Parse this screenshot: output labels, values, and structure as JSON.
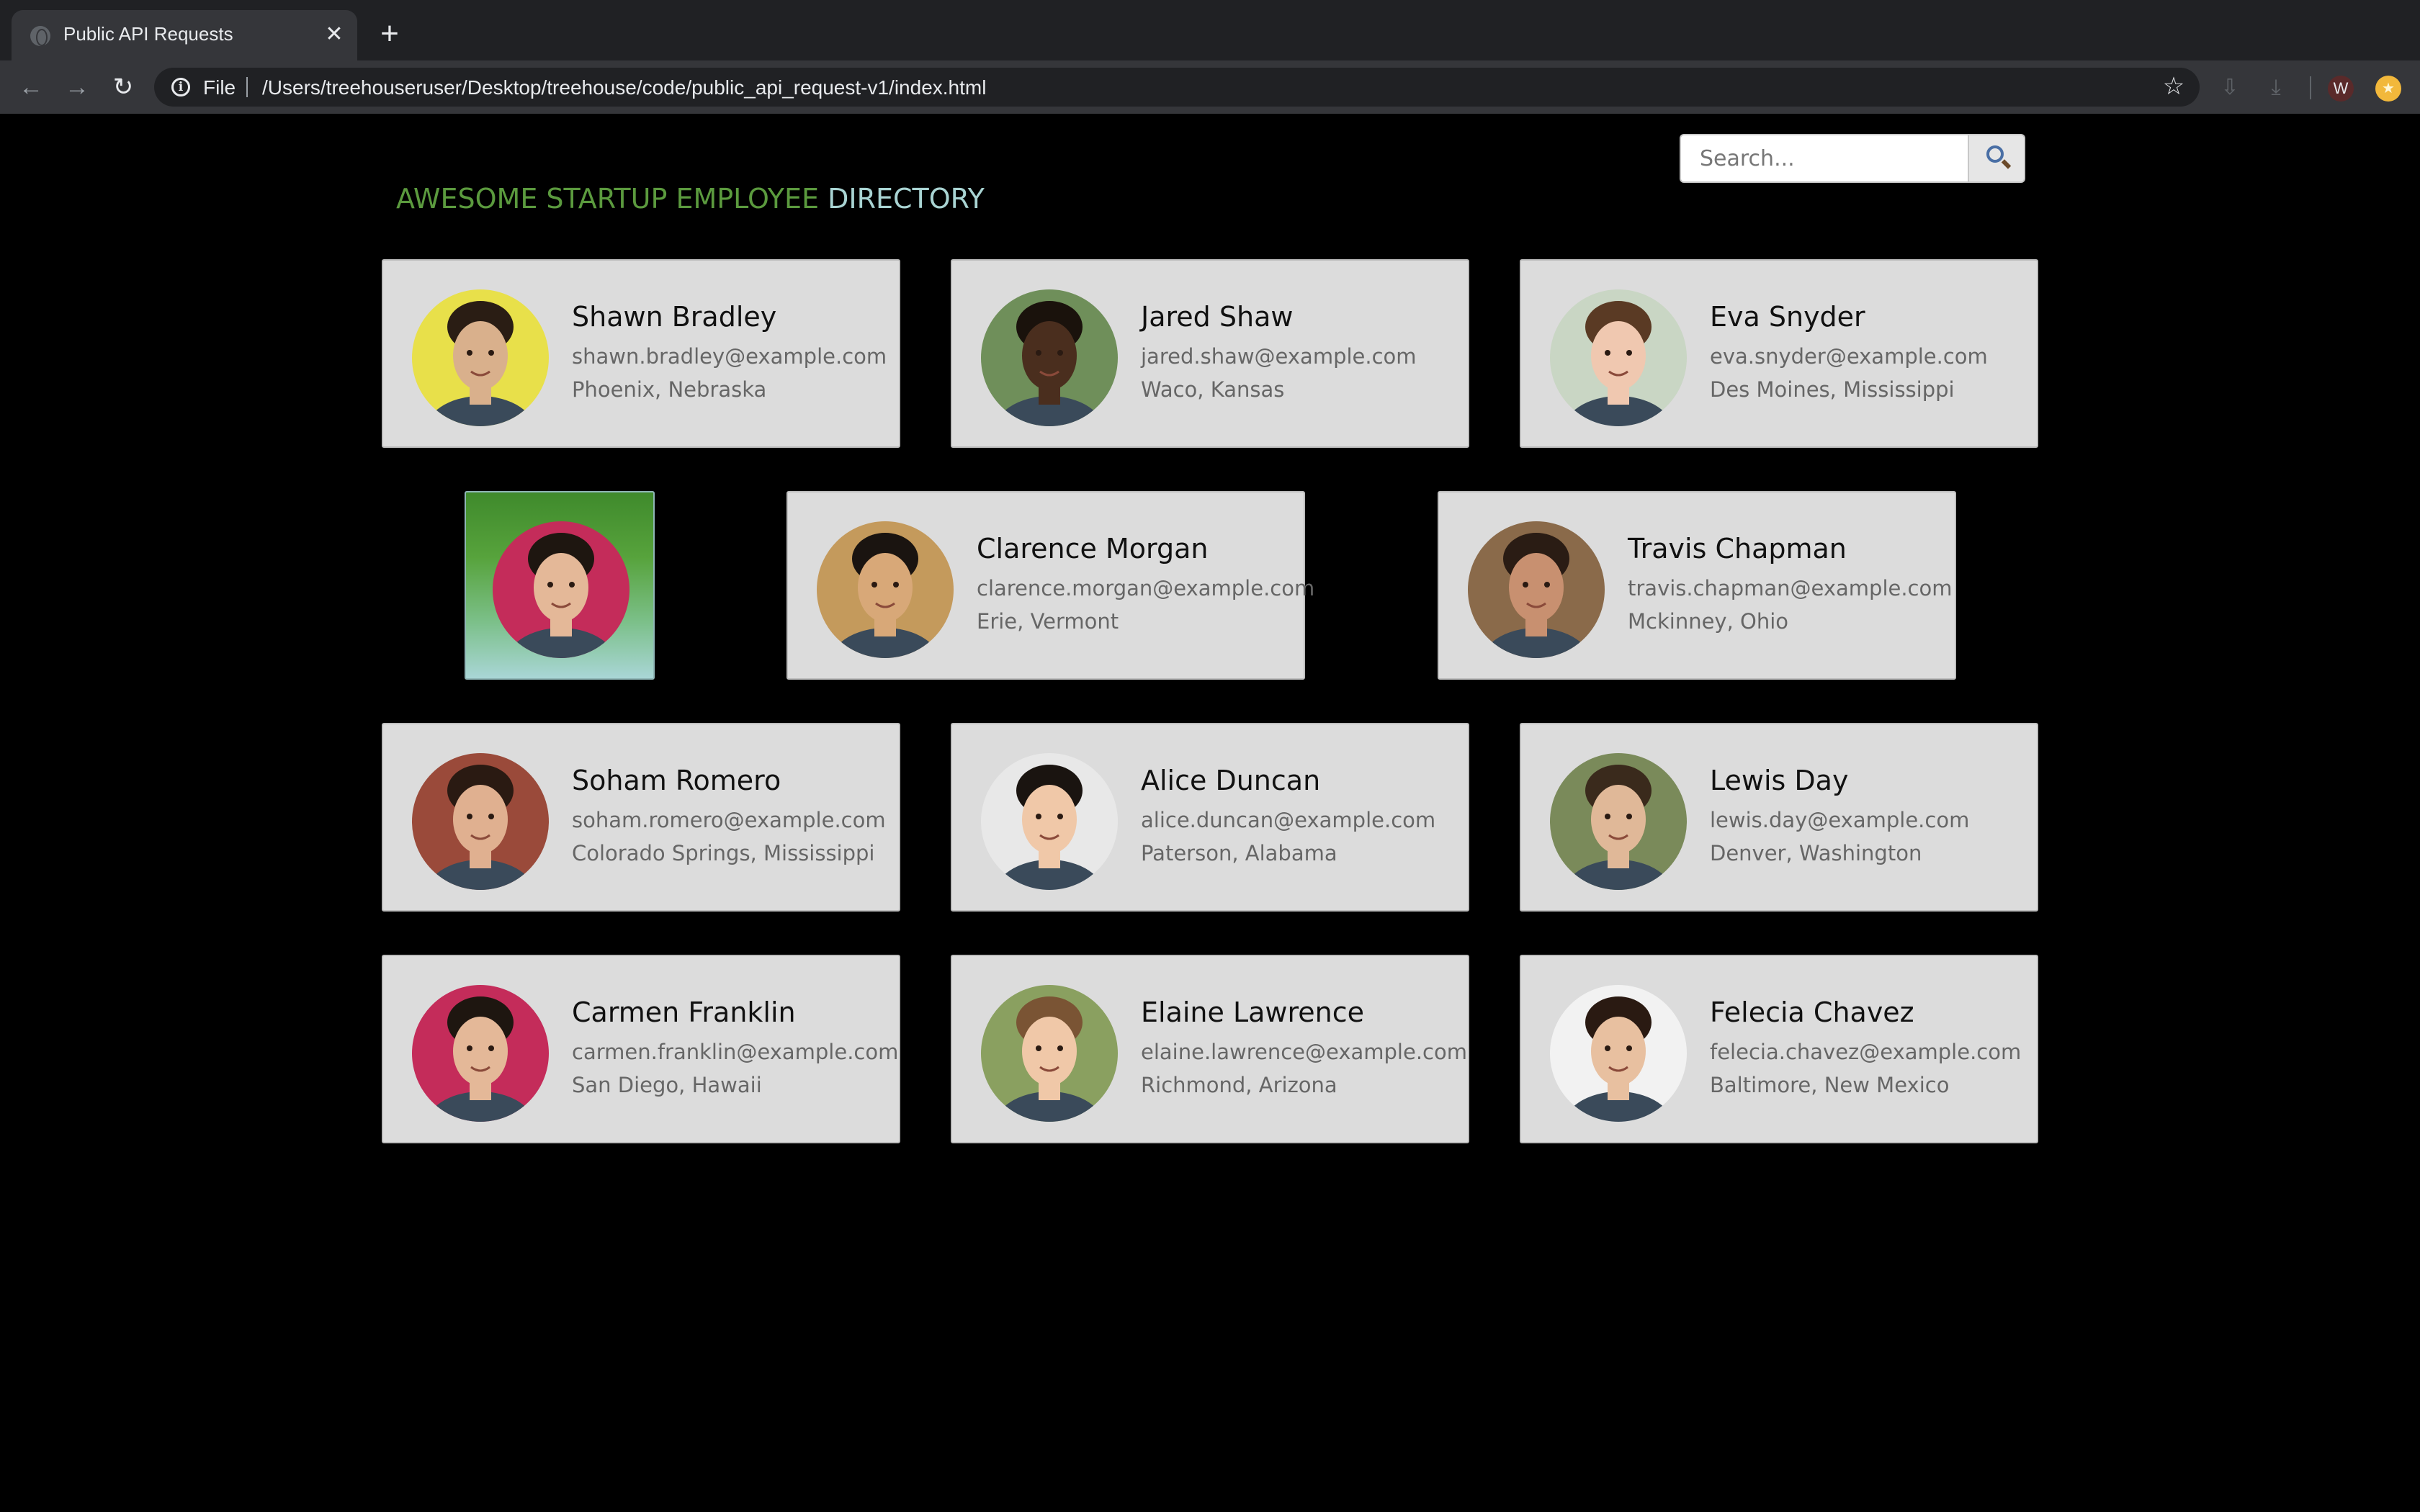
{
  "browser": {
    "tab_title": "Public API Requests",
    "tab_close": "✕",
    "new_tab": "+",
    "scheme_label": "File",
    "url": "/Users/treehouseruser/Desktop/treehouse/code/public_api_request-v1/index.html",
    "profile_initial": "W",
    "icons": {
      "back": "arrow-left-icon",
      "forward": "arrow-right-icon",
      "reload": "reload-icon",
      "info": "info-icon",
      "star": "star-icon",
      "extension_1": "download-shield-icon",
      "extension_2": "download-icon",
      "update": "update-icon"
    }
  },
  "header": {
    "title_green": "AWESOME STARTUP EMPLOYEE",
    "title_light": "DIRECTORY",
    "title_green_color": "#5b9a3e",
    "title_light_color": "#a9d4d3"
  },
  "search": {
    "placeholder": "Search...",
    "value": "",
    "button_icon": "magnifier-icon"
  },
  "employees": [
    {
      "name": "Shawn Bradley",
      "email": "shawn.bradley@example.com",
      "location": "Phoenix, Nebraska",
      "avatar_bg": "#e8e04a",
      "skin": "#d9b08c",
      "hair": "#2a1d14"
    },
    {
      "name": "Jared Shaw",
      "email": "jared.shaw@example.com",
      "location": "Waco, Kansas",
      "avatar_bg": "#6f8f5a",
      "skin": "#4a2e1e",
      "hair": "#1a120c"
    },
    {
      "name": "Eva Snyder",
      "email": "eva.snyder@example.com",
      "location": "Des Moines, Mississippi",
      "avatar_bg": "#c9d6c4",
      "skin": "#f0c8b0",
      "hair": "#5a3a24"
    },
    {
      "name": "",
      "email": "",
      "location": "",
      "avatar_bg": "#c42c5a",
      "skin": "#e4b898",
      "hair": "#1e1610",
      "highlight": true
    },
    {
      "name": "Clarence Morgan",
      "email": "clarence.morgan@example.com",
      "location": "Erie, Vermont",
      "avatar_bg": "#c49a5c",
      "skin": "#d8a878",
      "hair": "#1a1410"
    },
    {
      "name": "Travis Chapman",
      "email": "travis.chapman@example.com",
      "location": "Mckinney, Ohio",
      "avatar_bg": "#8a6a4a",
      "skin": "#c89070",
      "hair": "#2a1c14"
    },
    {
      "name": "Soham Romero",
      "email": "soham.romero@example.com",
      "location": "Colorado Springs, Mississippi",
      "avatar_bg": "#9a4a3a",
      "skin": "#e0b090",
      "hair": "#2a1a12"
    },
    {
      "name": "Alice Duncan",
      "email": "alice.duncan@example.com",
      "location": "Paterson, Alabama",
      "avatar_bg": "#e8e8e8",
      "skin": "#f0c8a8",
      "hair": "#1a1410"
    },
    {
      "name": "Lewis Day",
      "email": "lewis.day@example.com",
      "location": "Denver, Washington",
      "avatar_bg": "#7a8a5a",
      "skin": "#e0b898",
      "hair": "#3a2a1c"
    },
    {
      "name": "Carmen Franklin",
      "email": "carmen.franklin@example.com",
      "location": "San Diego, Hawaii",
      "avatar_bg": "#c42c5a",
      "skin": "#e4b898",
      "hair": "#1e1610"
    },
    {
      "name": "Elaine Lawrence",
      "email": "elaine.lawrence@example.com",
      "location": "Richmond, Arizona",
      "avatar_bg": "#8aa060",
      "skin": "#f0c8a8",
      "hair": "#7a5434"
    },
    {
      "name": "Felecia Chavez",
      "email": "felecia.chavez@example.com",
      "location": "Baltimore, New Mexico",
      "avatar_bg": "#f2f2f2",
      "skin": "#e8c0a0",
      "hair": "#2a1a12"
    }
  ]
}
